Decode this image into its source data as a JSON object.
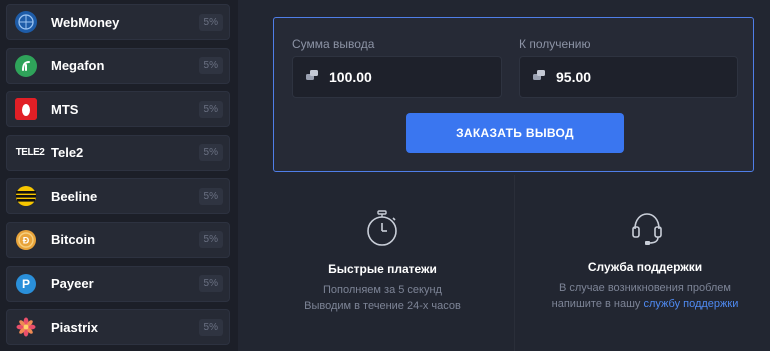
{
  "methods": [
    {
      "name": "WebMoney",
      "fee": "5%",
      "icon": "webmoney-icon",
      "color": "#1e5ca8"
    },
    {
      "name": "Megafon",
      "fee": "5%",
      "icon": "megafon-icon",
      "color": "#2fa35a"
    },
    {
      "name": "MTS",
      "fee": "5%",
      "icon": "mts-icon",
      "color": "#e11f26"
    },
    {
      "name": "Tele2",
      "fee": "5%",
      "icon": "tele2-icon",
      "color": "#ffffff",
      "logo_text": "TELE2"
    },
    {
      "name": "Beeline",
      "fee": "5%",
      "icon": "beeline-icon",
      "color": "#f7c600"
    },
    {
      "name": "Bitcoin",
      "fee": "5%",
      "icon": "bitcoin-icon",
      "color": "#e8a33a"
    },
    {
      "name": "Payeer",
      "fee": "5%",
      "icon": "payeer-icon",
      "color": "#2a8fd9"
    },
    {
      "name": "Piastrix",
      "fee": "5%",
      "icon": "piastrix-icon",
      "color": "#e94f6b"
    }
  ],
  "withdraw": {
    "amount_label": "Сумма вывода",
    "amount_value": "100.00",
    "receive_label": "К получению",
    "receive_value": "95.00",
    "button_label": "ЗАКАЗАТЬ ВЫВОД"
  },
  "features": {
    "fast": {
      "icon": "stopwatch-icon",
      "title": "Быстрые платежи",
      "line1": "Пополняем за 5 секунд",
      "line2": "Выводим в течение 24-х часов"
    },
    "support": {
      "icon": "headset-icon",
      "title": "Служба поддержки",
      "line1": "В случае возникновения проблем",
      "line2_prefix": "напишите в нашу ",
      "line2_link": "службу поддержки"
    }
  },
  "colors": {
    "accent": "#3a76f0",
    "panel_border": "#4f7ee8",
    "link": "#4f8af2"
  }
}
